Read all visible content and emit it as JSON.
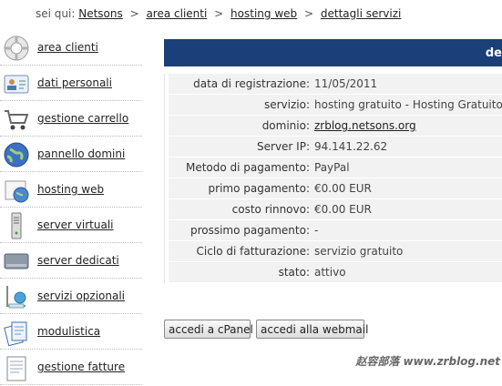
{
  "breadcrumb": {
    "prefix": "sei qui:",
    "items": [
      "Netsons",
      "area clienti",
      "hosting web",
      "dettagli servizi"
    ],
    "separator": ">"
  },
  "sidebar": {
    "items": [
      {
        "label": "area clienti",
        "icon": "lifebuoy-icon"
      },
      {
        "label": "dati personali",
        "icon": "id-card-icon"
      },
      {
        "label": "gestione carrello",
        "icon": "shopping-cart-icon"
      },
      {
        "label": "pannello domini",
        "icon": "globe-icon"
      },
      {
        "label": "hosting web",
        "icon": "hosting-folder-icon"
      },
      {
        "label": "server virtuali",
        "icon": "server-tower-icon"
      },
      {
        "label": "server dedicati",
        "icon": "hard-drive-icon"
      },
      {
        "label": "servizi opzionali",
        "icon": "optional-services-icon"
      },
      {
        "label": "modulistica",
        "icon": "documents-icon"
      },
      {
        "label": "gestione fatture",
        "icon": "invoice-icon"
      }
    ]
  },
  "header": {
    "title": "de"
  },
  "details": {
    "rows": [
      {
        "key": "data di registrazione:",
        "value": "11/05/2011"
      },
      {
        "key": "servizio:",
        "value": "hosting gratuito - Hosting Gratuito Pro"
      },
      {
        "key": "dominio:",
        "value": "zrblog.netsons.org",
        "link": true
      },
      {
        "key": "Server IP:",
        "value": "94.141.22.62"
      },
      {
        "key": "Metodo di pagamento:",
        "value": "PayPal"
      },
      {
        "key": "primo pagamento:",
        "value": "€0.00 EUR"
      },
      {
        "key": "costo rinnovo:",
        "value": "€0.00 EUR"
      },
      {
        "key": "prossimo pagamento:",
        "value": "-"
      },
      {
        "key": "Ciclo di fatturazione:",
        "value": "servizio gratuito"
      },
      {
        "key": "stato:",
        "value": "attivo"
      }
    ]
  },
  "buttons": {
    "cpanel": "accedi a cPanel",
    "webmail": "accedi alla webmail"
  },
  "watermark": "赵容部落 www.zrblog.net",
  "colors": {
    "header": "#1b3f78",
    "row_bg": "#f2f2f2"
  }
}
